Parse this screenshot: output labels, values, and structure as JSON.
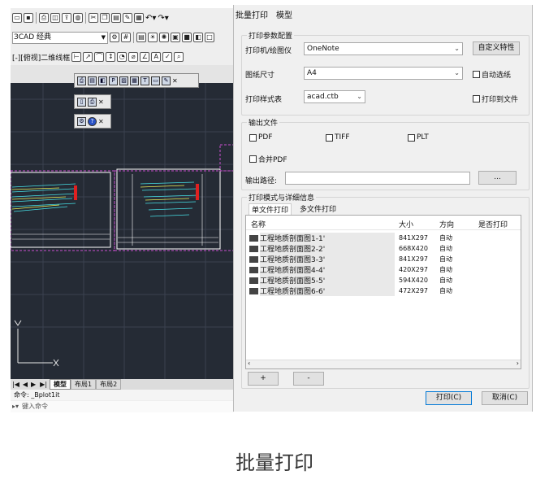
{
  "cad": {
    "workspace_label": "ЗCAD 经典",
    "view_label": "[-][俯视]二维线框",
    "layout_tabs": [
      "模型",
      "布局1",
      "布局2"
    ],
    "command_history": "命令: _Bplot1it",
    "command_prompt": "键入命令",
    "axis_x": "X",
    "axis_y": "Y",
    "colors": {
      "workspace_bg": "#252b35",
      "frame": "#c94fd0"
    }
  },
  "dialog": {
    "menu": [
      "批量打印",
      "模型"
    ],
    "print_config": {
      "group_title": "打印参数配置",
      "printer_label": "打印机/绘图仪",
      "printer_value": "OneNote",
      "paper_label": "图纸尺寸",
      "paper_value": "A4",
      "style_label": "打印样式表",
      "style_value": "acad.ctb",
      "custom_button": "自定义特性",
      "auto_paper": "自动选纸",
      "print_to_file": "打印到文件"
    },
    "output": {
      "group_title": "输出文件",
      "pdf": "PDF",
      "tiff": "TIFF",
      "plt": "PLT",
      "merge_pdf": "合并PDF",
      "path_label": "输出路径:",
      "path_value": "",
      "browse": "..."
    },
    "details": {
      "group_title": "打印模式与详细信息",
      "tabs": [
        "单文件打印",
        "多文件打印"
      ],
      "columns": [
        "名称",
        "大小",
        "方向",
        "是否打印"
      ],
      "rows": [
        {
          "name": "工程地质剖面图1-1'",
          "size": "841X297",
          "dir": "自动"
        },
        {
          "name": "工程地质剖面图2-2'",
          "size": "668X420",
          "dir": "自动"
        },
        {
          "name": "工程地质剖面图3-3'",
          "size": "841X297",
          "dir": "自动"
        },
        {
          "name": "工程地质剖面图4-4'",
          "size": "420X297",
          "dir": "自动"
        },
        {
          "name": "工程地质剖面图5-5'",
          "size": "594X420",
          "dir": "自动"
        },
        {
          "name": "工程地质剖面图6-6'",
          "size": "472X297",
          "dir": "自动"
        }
      ],
      "add": "+",
      "remove": "-"
    },
    "print_button": "打印(C)",
    "cancel_button": "取消(C)"
  },
  "caption": "批量打印"
}
